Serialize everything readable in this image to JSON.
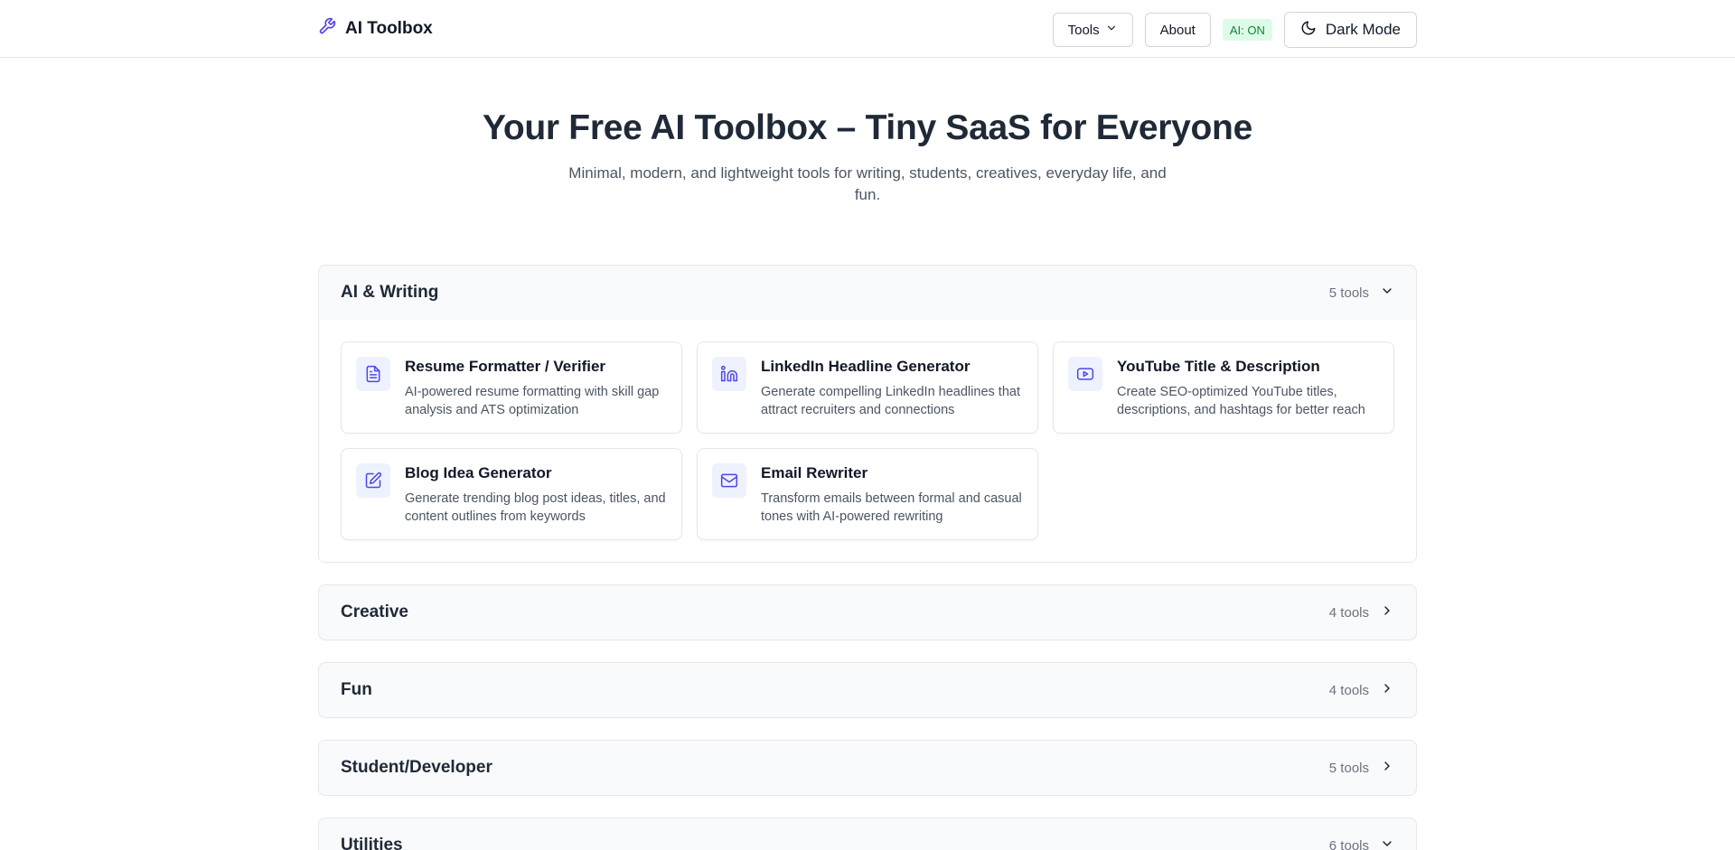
{
  "header": {
    "brand": "AI Toolbox",
    "nav": {
      "tools_label": "Tools",
      "about_label": "About",
      "ai_status": "AI: ON",
      "dark_mode_label": "Dark Mode"
    }
  },
  "hero": {
    "title": "Your Free AI Toolbox – Tiny SaaS for Everyone",
    "subtitle": "Minimal, modern, and lightweight tools for writing, students, creatives, everyday life, and fun."
  },
  "sections": [
    {
      "title": "AI & Writing",
      "count": "5 tools",
      "expanded": true,
      "tools": [
        {
          "title": "Resume Formatter / Verifier",
          "desc": "AI-powered resume formatting with skill gap analysis and ATS optimization",
          "icon": "document-icon"
        },
        {
          "title": "LinkedIn Headline Generator",
          "desc": "Generate compelling LinkedIn headlines that attract recruiters and connections",
          "icon": "linkedin-icon"
        },
        {
          "title": "YouTube Title & Description",
          "desc": "Create SEO-optimized YouTube titles, descriptions, and hashtags for better reach",
          "icon": "youtube-icon"
        },
        {
          "title": "Blog Idea Generator",
          "desc": "Generate trending blog post ideas, titles, and content outlines from keywords",
          "icon": "edit-icon"
        },
        {
          "title": "Email Rewriter",
          "desc": "Transform emails between formal and casual tones with AI-powered rewriting",
          "icon": "mail-icon"
        }
      ]
    },
    {
      "title": "Creative",
      "count": "4 tools",
      "expanded": false
    },
    {
      "title": "Fun",
      "count": "4 tools",
      "expanded": false
    },
    {
      "title": "Student/Developer",
      "count": "5 tools",
      "expanded": false
    },
    {
      "title": "Utilities",
      "count": "6 tools",
      "expanded": false
    }
  ],
  "colors": {
    "accent": "#4f46e5",
    "ai_badge_bg": "#dcfce7",
    "ai_badge_text": "#15803d"
  }
}
